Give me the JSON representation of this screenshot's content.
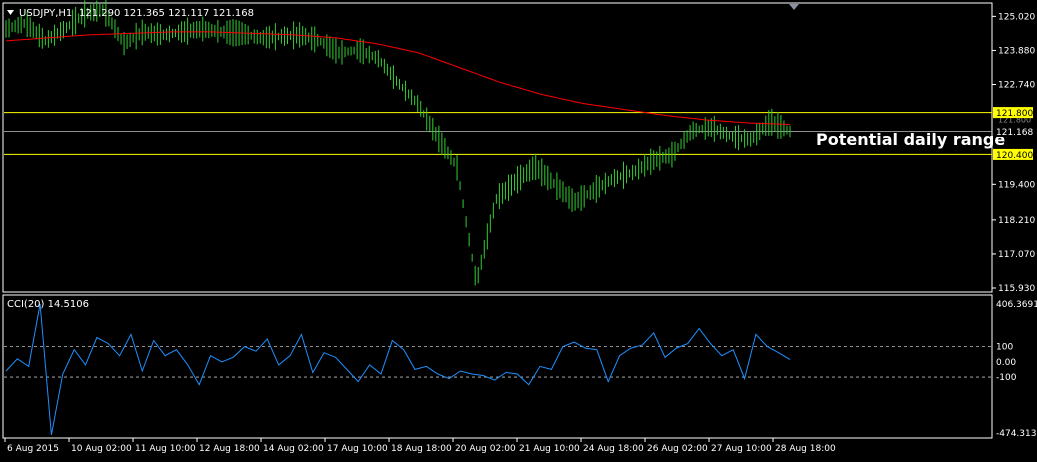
{
  "window": {
    "symbol_caption": "USDJPY,H1",
    "ohlc_caption": "121.290 121.365 121.117 121.168",
    "menu_icon": "triangle-down-icon",
    "shift_icon": "triangle-down-icon"
  },
  "colors": {
    "background": "#000000",
    "bars": "#32cd32",
    "moving_average": "#ff0000",
    "range_lines": "#ffff00",
    "price_line": "#c0c0c0",
    "cci_line": "#1e90ff",
    "axis_text": "#ffffff",
    "frame": "#ffffff"
  },
  "annotation": "Potential daily range",
  "price_panel": {
    "axis_labels": [
      "125.020",
      "123.880",
      "122.740",
      "120.400",
      "119.400",
      "118.210",
      "117.070",
      "115.930"
    ],
    "axis_values": [
      125.02,
      123.88,
      122.74,
      120.4,
      119.4,
      118.21,
      117.07,
      115.93
    ],
    "range_high_label": "121.800",
    "range_high_value": 121.8,
    "range_low_label": "120.400",
    "range_low_value": 120.4,
    "current_price_label": "121.168",
    "current_price_value": 121.168,
    "faint_label": "121.800"
  },
  "cci_panel": {
    "caption": "CCI(20) 14.5106",
    "axis_labels": [
      "406.3691",
      "100",
      "0.00",
      "-100",
      "-474.3136"
    ],
    "axis_values": [
      406.3691,
      100,
      0,
      -100,
      -474.3136
    ]
  },
  "time_axis": {
    "labels": [
      "6 Aug 2015",
      "10 Aug 02:00",
      "11 Aug 10:00",
      "12 Aug 18:00",
      "14 Aug 02:00",
      "17 Aug 10:00",
      "18 Aug 18:00",
      "20 Aug 02:00",
      "21 Aug 10:00",
      "24 Aug 18:00",
      "26 Aug 02:00",
      "27 Aug 10:00",
      "28 Aug 18:00"
    ]
  },
  "chart_data": {
    "type": "line",
    "x_labels": [
      "6 Aug 2015",
      "10 Aug 02:00",
      "11 Aug 10:00",
      "12 Aug 18:00",
      "14 Aug 02:00",
      "17 Aug 10:00",
      "18 Aug 18:00",
      "20 Aug 02:00",
      "21 Aug 10:00",
      "24 Aug 18:00",
      "26 Aug 02:00",
      "27 Aug 10:00",
      "28 Aug 18:00"
    ],
    "price_keypoints": [
      124.6,
      124.8,
      124.2,
      124.6,
      125.1,
      125.25,
      124.1,
      124.5,
      124.4,
      124.5,
      124.6,
      124.5,
      124.45,
      124.3,
      124.35,
      124.4,
      124.2,
      123.8,
      123.9,
      123.6,
      122.8,
      122.1,
      121.0,
      120.0,
      116.1,
      118.9,
      119.5,
      120.0,
      119.4,
      118.8,
      119.2,
      119.6,
      119.8,
      120.2,
      120.4,
      121.2,
      121.3,
      121.0,
      120.9,
      121.5,
      121.168
    ],
    "ma_keypoints": [
      124.2,
      124.3,
      124.4,
      124.45,
      124.5,
      124.5,
      124.45,
      124.4,
      124.3,
      124.1,
      123.8,
      123.3,
      122.8,
      122.4,
      122.1,
      121.9,
      121.7,
      121.55,
      121.45,
      121.4
    ],
    "price_range": [
      115.93,
      125.3
    ],
    "cci_keypoints": [
      -60,
      20,
      -30,
      380,
      -480,
      -80,
      80,
      -20,
      160,
      120,
      40,
      180,
      -60,
      140,
      40,
      80,
      -20,
      -150,
      40,
      0,
      30,
      100,
      70,
      150,
      -20,
      40,
      180,
      -70,
      60,
      30,
      -50,
      -130,
      -20,
      -80,
      140,
      80,
      -50,
      -30,
      -80,
      -110,
      -60,
      -80,
      -90,
      -120,
      -70,
      -80,
      -150,
      -30,
      -50,
      100,
      130,
      90,
      80,
      -130,
      40,
      90,
      110,
      190,
      30,
      90,
      120,
      220,
      120,
      40,
      80,
      -110,
      180,
      100,
      60,
      14.5106
    ],
    "cci_range": [
      -474.3136,
      406.3691
    ],
    "title": "",
    "xlabel": "",
    "ylabel": ""
  }
}
